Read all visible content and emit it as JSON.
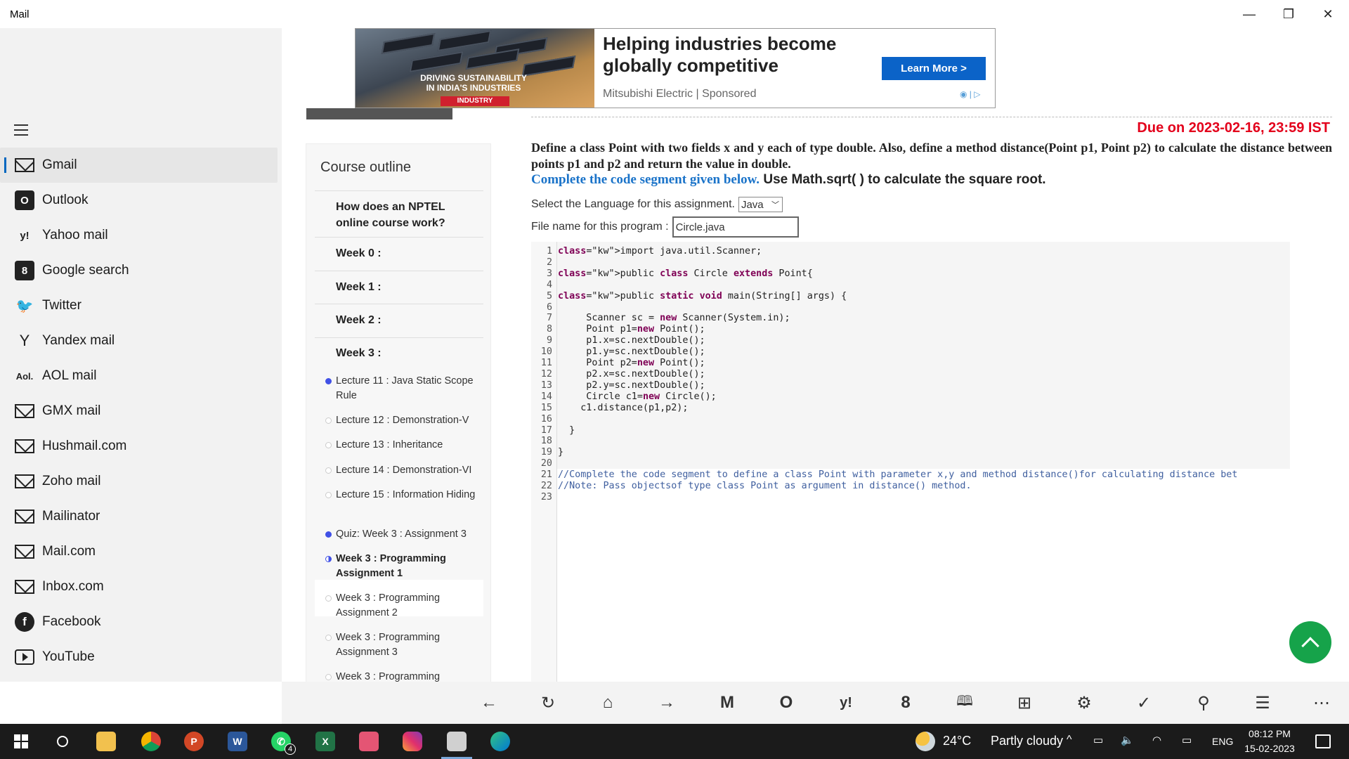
{
  "window": {
    "title": "Mail",
    "controls": {
      "minimize": "—",
      "maximize": "❐",
      "close": "✕"
    }
  },
  "sidebar": {
    "items": [
      {
        "label": "Gmail",
        "icon": "gmail-icon",
        "active": true
      },
      {
        "label": "Outlook",
        "icon": "outlook-icon"
      },
      {
        "label": "Yahoo mail",
        "icon": "yahoo-icon"
      },
      {
        "label": "Google search",
        "icon": "google-icon"
      },
      {
        "label": "Twitter",
        "icon": "twitter-icon"
      },
      {
        "label": "Yandex mail",
        "icon": "yandex-icon"
      },
      {
        "label": "AOL mail",
        "icon": "aol-icon"
      },
      {
        "label": "GMX mail",
        "icon": "envelope-icon"
      },
      {
        "label": "Hushmail.com",
        "icon": "envelope-icon"
      },
      {
        "label": "Zoho mail",
        "icon": "envelope-icon"
      },
      {
        "label": "Mailinator",
        "icon": "envelope-icon"
      },
      {
        "label": "Mail.com",
        "icon": "envelope-icon"
      },
      {
        "label": "Inbox.com",
        "icon": "envelope-icon"
      },
      {
        "label": "Facebook",
        "icon": "facebook-icon"
      },
      {
        "label": "YouTube",
        "icon": "youtube-icon"
      }
    ]
  },
  "ad": {
    "image_text_line1": "DRIVING SUSTAINABILITY",
    "image_text_line2": "IN INDIA'S INDUSTRIES",
    "image_badge": "INDUSTRY",
    "headline_line1": "Helping industries become",
    "headline_line2": "globally competitive",
    "sponsor": "Mitsubishi Electric | Sponsored",
    "cta": "Learn More >"
  },
  "outline": {
    "title": "Course outline",
    "faq": "How does an NPTEL online course work?",
    "weeks": [
      "Week 0 :",
      "Week 1 :",
      "Week 2 :",
      "Week 3 :"
    ],
    "items": [
      {
        "label": "Lecture 11 : Java Static Scope Rule",
        "status": "done"
      },
      {
        "label": "Lecture 12 : Demonstration-V",
        "status": "todo"
      },
      {
        "label": "Lecture 13 : Inheritance",
        "status": "todo"
      },
      {
        "label": "Lecture 14 : Demonstration-VI",
        "status": "todo"
      },
      {
        "label": "Lecture 15 : Information Hiding",
        "status": "todo"
      },
      {
        "label": "Quiz: Week 3 : Assignment 3",
        "status": "done"
      },
      {
        "label": "Week 3 : Programming Assignment 1",
        "status": "current"
      },
      {
        "label": "Week 3 : Programming Assignment 2",
        "status": "todo"
      },
      {
        "label": "Week 3 : Programming Assignment 3",
        "status": "todo"
      },
      {
        "label": "Week 3 : Programming",
        "status": "todo"
      }
    ]
  },
  "assignment": {
    "due": "Due on 2023-02-16, 23:59 IST",
    "question": "Define a class Point with two fields x and y each of type double. Also, define a method distance(Point p1, Point p2) to calculate the distance between points p1 and p2 and return the value in double.",
    "instruction_blue": "Complete the code segment given below.",
    "instruction_rest": " Use Math.sqrt( ) to calculate the square root.",
    "language_label": "Select the Language for this assignment.",
    "language_value": "Java",
    "filename_label": "File name for this program :",
    "filename_value": "Circle.java"
  },
  "code": {
    "lines": [
      "import java.util.Scanner;",
      "",
      "public class Circle extends Point{",
      "",
      "public static void main(String[] args) {",
      "",
      "     Scanner sc = new Scanner(System.in);",
      "     Point p1=new Point();",
      "     p1.x=sc.nextDouble();",
      "     p1.y=sc.nextDouble();",
      "     Point p2=new Point();",
      "     p2.x=sc.nextDouble();",
      "     p2.y=sc.nextDouble();",
      "     Circle c1=new Circle();",
      "    c1.distance(p1,p2);",
      "",
      "  }",
      "",
      "}",
      "",
      "//Complete the code segment to define a class Point with parameter x,y and method distance()for calculating distance bet",
      "//Note: Pass objectsof type class Point as argument in distance() method.",
      ""
    ]
  },
  "appbar": {
    "buttons": [
      "←",
      "↻",
      "⌂",
      "→",
      "M",
      "O",
      "y!",
      "8",
      "🕮",
      "⊞",
      "⚙",
      "✓",
      "⚲",
      "☰",
      "⋯"
    ]
  },
  "taskbar": {
    "weather_temp": "24°C",
    "weather_desc": "Partly cloudy",
    "language": "ENG",
    "time": "08:12 PM",
    "date": "15-02-2023",
    "whatsapp_badge": "4"
  },
  "colors": {
    "accent_blue": "#0b63c8",
    "due_red": "#e3001b",
    "fab_green": "#16a34a",
    "taskbar": "#1b1b1b"
  }
}
